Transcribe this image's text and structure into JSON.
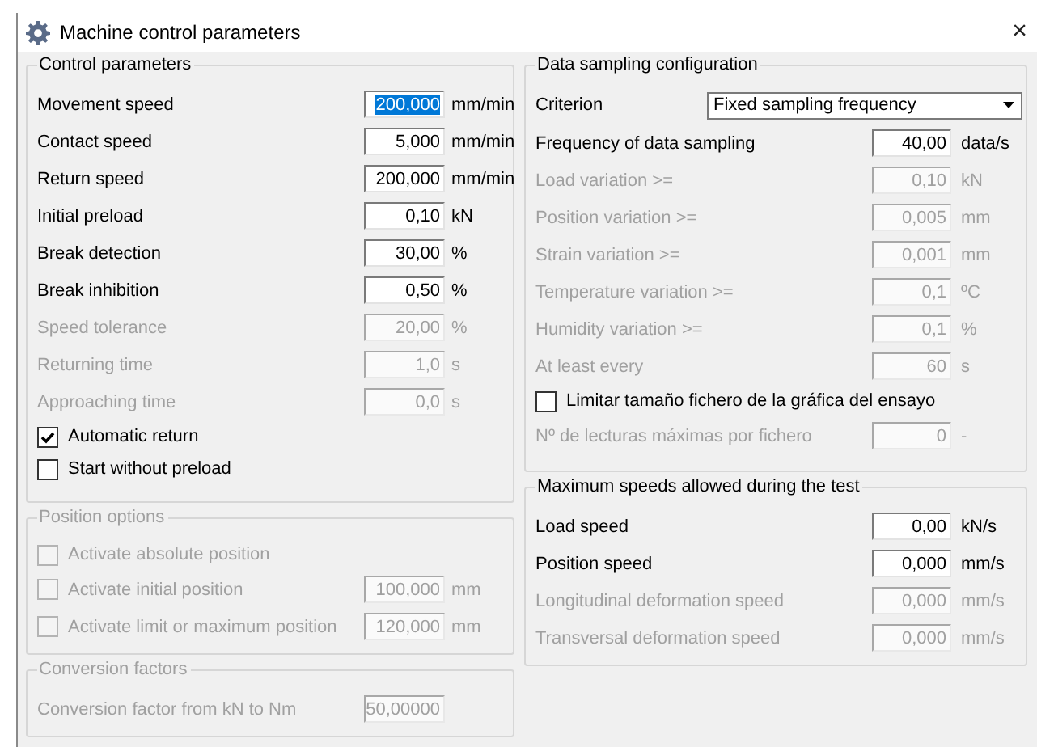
{
  "window": {
    "title": "Machine control parameters",
    "close": "×"
  },
  "columns": [
    {
      "groups": [
        {
          "title": "Control parameters",
          "disabled": false,
          "rows": [
            {
              "kind": "field",
              "label": "Movement speed",
              "value": "200,000",
              "unit": "mm/min",
              "disabled": false,
              "text_selected": true
            },
            {
              "kind": "field",
              "label": "Contact speed",
              "value": "5,000",
              "unit": "mm/min",
              "disabled": false,
              "text_selected": false
            },
            {
              "kind": "field",
              "label": "Return speed",
              "value": "200,000",
              "unit": "mm/min",
              "disabled": false,
              "text_selected": false
            },
            {
              "kind": "field",
              "label": "Initial preload",
              "value": "0,10",
              "unit": "kN",
              "disabled": false,
              "text_selected": false
            },
            {
              "kind": "field",
              "label": "Break detection",
              "value": "30,00",
              "unit": "%",
              "disabled": false,
              "text_selected": false
            },
            {
              "kind": "field",
              "label": "Break inhibition",
              "value": "0,50",
              "unit": "%",
              "disabled": false,
              "text_selected": false
            },
            {
              "kind": "field",
              "label": "Speed tolerance",
              "value": "20,00",
              "unit": "%",
              "disabled": true,
              "text_selected": false
            },
            {
              "kind": "field",
              "label": "Returning time",
              "value": "1,0",
              "unit": "s",
              "disabled": true,
              "text_selected": false
            },
            {
              "kind": "field",
              "label": "Approaching time",
              "value": "0,0",
              "unit": "s",
              "disabled": true,
              "text_selected": false
            },
            {
              "kind": "checkbox",
              "label": "Automatic return",
              "checked": true,
              "disabled": false
            },
            {
              "kind": "checkbox",
              "label": "Start without preload",
              "checked": false,
              "disabled": false
            }
          ]
        },
        {
          "title": "Position options",
          "disabled": true,
          "rows": [
            {
              "kind": "checkbox",
              "label": "Activate absolute position",
              "checked": false,
              "disabled": true
            },
            {
              "kind": "checkbox_field",
              "label": "Activate initial position",
              "checked": false,
              "disabled": true,
              "value": "100,000",
              "unit": "mm"
            },
            {
              "kind": "checkbox_field",
              "label": "Activate limit or maximum position",
              "checked": false,
              "disabled": true,
              "value": "120,000",
              "unit": "mm"
            }
          ]
        },
        {
          "title": "Conversion factors",
          "disabled": true,
          "rows": [
            {
              "kind": "field",
              "label": "Conversion factor from kN to Nm",
              "value": "50,00000",
              "disabled": true,
              "text_selected": false
            }
          ]
        }
      ]
    },
    {
      "groups": [
        {
          "title": "Data sampling configuration",
          "disabled": false,
          "rows": [
            {
              "kind": "dropdown",
              "label": "Criterion",
              "value": "Fixed sampling frequency"
            },
            {
              "kind": "field",
              "label": "Frequency of data sampling",
              "value": "40,00",
              "unit": "data/s",
              "disabled": false,
              "text_selected": false
            },
            {
              "kind": "field",
              "label": "Load variation >=",
              "value": "0,10",
              "unit": "kN",
              "disabled": true,
              "text_selected": false
            },
            {
              "kind": "field",
              "label": "Position variation >=",
              "value": "0,005",
              "unit": "mm",
              "disabled": true,
              "text_selected": false
            },
            {
              "kind": "field",
              "label": "Strain variation >=",
              "value": "0,001",
              "unit": "mm",
              "disabled": true,
              "text_selected": false
            },
            {
              "kind": "field",
              "label": "Temperature variation >=",
              "value": "0,1",
              "unit": "ºC",
              "disabled": true,
              "text_selected": false
            },
            {
              "kind": "field",
              "label": "Humidity variation >=",
              "value": "0,1",
              "unit": "%",
              "disabled": true,
              "text_selected": false
            },
            {
              "kind": "field",
              "label": "At least every",
              "value": "60",
              "unit": "s",
              "disabled": true,
              "text_selected": false
            },
            {
              "kind": "checkbox",
              "label": "Limitar tamaño fichero de la gráfica del ensayo",
              "checked": false,
              "disabled": false
            },
            {
              "kind": "field",
              "label": "Nº de lecturas máximas por fichero",
              "value": "0",
              "unit": "-",
              "disabled": true,
              "text_selected": false
            }
          ]
        },
        {
          "title": "Maximum speeds allowed during the test",
          "disabled": false,
          "rows": [
            {
              "kind": "field",
              "label": "Load speed",
              "value": "0,00",
              "unit": "kN/s",
              "disabled": false,
              "text_selected": false
            },
            {
              "kind": "field",
              "label": "Position speed",
              "value": "0,000",
              "unit": "mm/s",
              "disabled": false,
              "text_selected": false
            },
            {
              "kind": "field",
              "label": "Longitudinal deformation speed",
              "value": "0,000",
              "unit": "mm/s",
              "disabled": true,
              "text_selected": false
            },
            {
              "kind": "field",
              "label": "Transversal deformation speed",
              "value": "0,000",
              "unit": "mm/s",
              "disabled": true,
              "text_selected": false
            }
          ]
        }
      ]
    }
  ]
}
